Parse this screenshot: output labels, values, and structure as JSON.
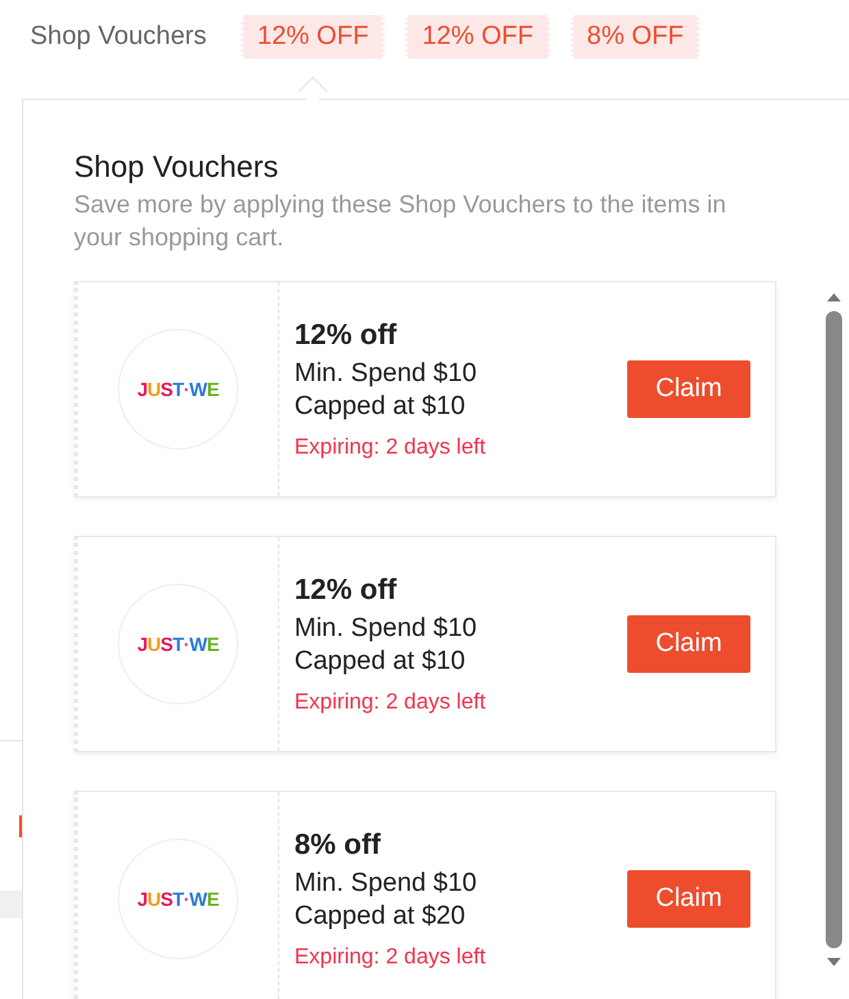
{
  "header": {
    "label": "Shop Vouchers",
    "tags": [
      "12% OFF",
      "12% OFF",
      "8% OFF"
    ]
  },
  "popup": {
    "title": "Shop Vouchers",
    "subtitle": "Save more by applying these Shop Vouchers to the items in your shopping cart.",
    "vouchers": [
      {
        "logo_text": "JUST·WE",
        "discount": "12% off",
        "min_spend": "Min. Spend $10",
        "cap": "Capped at $10",
        "expiry": "Expiring: 2 days left",
        "button": "Claim"
      },
      {
        "logo_text": "JUST·WE",
        "discount": "12% off",
        "min_spend": "Min. Spend $10",
        "cap": "Capped at $10",
        "expiry": "Expiring: 2 days left",
        "button": "Claim"
      },
      {
        "logo_text": "JUST·WE",
        "discount": "8% off",
        "min_spend": "Min. Spend $10",
        "cap": "Capped at $20",
        "expiry": "Expiring: 2 days left",
        "button": "Claim"
      }
    ]
  }
}
